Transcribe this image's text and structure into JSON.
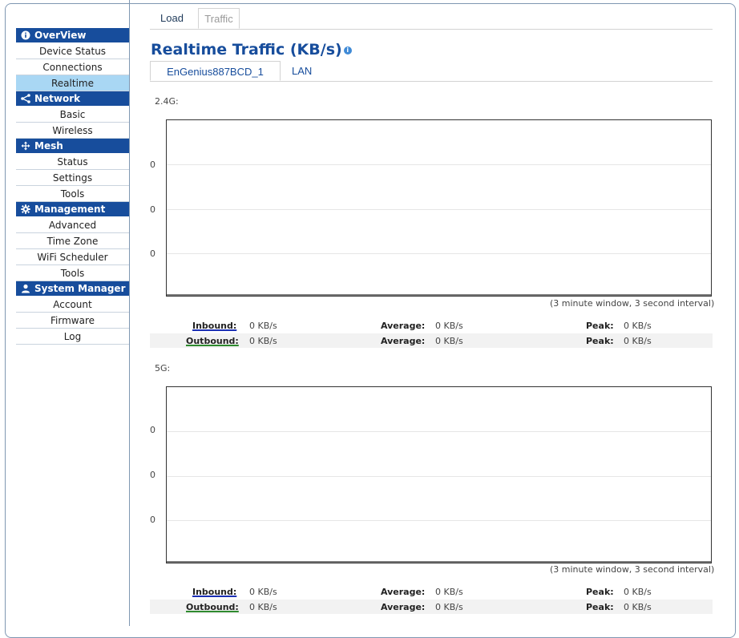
{
  "sidebar": {
    "sections": [
      {
        "title": "OverView",
        "icon": "info-icon",
        "items": [
          "Device Status",
          "Connections",
          "Realtime"
        ],
        "active": "Realtime"
      },
      {
        "title": "Network",
        "icon": "share-icon",
        "items": [
          "Basic",
          "Wireless"
        ]
      },
      {
        "title": "Mesh",
        "icon": "move-arrows-icon",
        "items": [
          "Status",
          "Settings",
          "Tools"
        ]
      },
      {
        "title": "Management",
        "icon": "gear-icon",
        "items": [
          "Advanced",
          "Time Zone",
          "WiFi Scheduler",
          "Tools"
        ]
      },
      {
        "title": "System Manager",
        "icon": "user-icon",
        "items": [
          "Account",
          "Firmware",
          "Log"
        ]
      }
    ]
  },
  "top_tabs": {
    "load": "Load",
    "traffic": "Traffic",
    "active": "Traffic"
  },
  "page_title": "Realtime Traffic (KB/s)",
  "info_icon": "i",
  "sub_tabs": {
    "first": "EnGenius887BCD_1",
    "second": "LAN",
    "active": "EnGenius887BCD_1"
  },
  "graphs": [
    {
      "band": "2.4G:",
      "y_labels": [
        "0",
        "0",
        "0"
      ],
      "window_note": "(3 minute window, 3 second interval)",
      "inbound": {
        "label": "Inbound:",
        "value": "0 KB/s",
        "avg_label": "Average:",
        "avg": "0 KB/s",
        "peak_label": "Peak:",
        "peak": "0 KB/s"
      },
      "outbound": {
        "label": "Outbound:",
        "value": "0 KB/s",
        "avg_label": "Average:",
        "avg": "0 KB/s",
        "peak_label": "Peak:",
        "peak": "0 KB/s"
      }
    },
    {
      "band": "5G:",
      "y_labels": [
        "0",
        "0",
        "0"
      ],
      "window_note": "(3 minute window, 3 second interval)",
      "inbound": {
        "label": "Inbound:",
        "value": "0 KB/s",
        "avg_label": "Average:",
        "avg": "0 KB/s",
        "peak_label": "Peak:",
        "peak": "0 KB/s"
      },
      "outbound": {
        "label": "Outbound:",
        "value": "0 KB/s",
        "avg_label": "Average:",
        "avg": "0 KB/s",
        "peak_label": "Peak:",
        "peak": "0 KB/s"
      }
    }
  ],
  "colors": {
    "header_blue": "#174d9c",
    "active_item": "#a9d7f4",
    "inbound_line": "#1b2fb5",
    "outbound_line": "#2f8a2f"
  }
}
